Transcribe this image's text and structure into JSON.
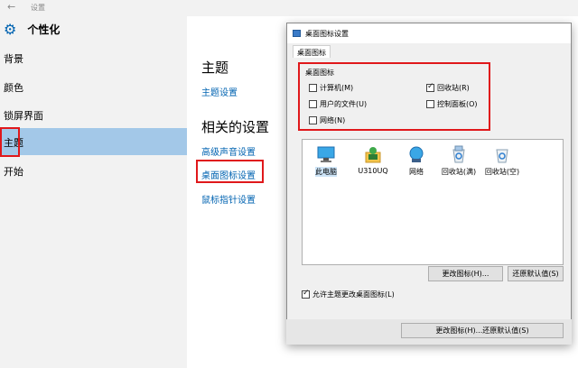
{
  "settings": {
    "window_title": "设置",
    "header_label": "个性化",
    "nav": [
      "背景",
      "颜色",
      "锁屏界面",
      "主题",
      "开始"
    ],
    "theme_heading": "主题",
    "theme_settings_link": "主题设置",
    "related_heading": "相关的设置",
    "related_links": [
      "高级声音设置",
      "桌面图标设置",
      "鼠标指针设置"
    ]
  },
  "dialog": {
    "title": "桌面图标设置",
    "tab": "桌面图标",
    "group_label": "桌面图标",
    "checkboxes": [
      {
        "label": "计算机(M)",
        "checked": false
      },
      {
        "label": "回收站(R)",
        "checked": true
      },
      {
        "label": "用户的文件(U)",
        "checked": false
      },
      {
        "label": "控制面板(O)",
        "checked": false
      },
      {
        "label": "网络(N)",
        "checked": false
      }
    ],
    "icons": [
      "此电脑",
      "U310UQ",
      "网络",
      "回收站(满)",
      "回收站(空)"
    ],
    "buttons": {
      "change_icon": "更改图标(H)...",
      "restore_default": "还原默认值(S)",
      "bottom": "更改图标(H)...还原默认值(S)"
    },
    "allow_themes": {
      "label": "允许主题更改桌面图标(L)",
      "checked": true
    }
  },
  "colors": {
    "accent": "#0063b1",
    "highlight": "#e0181b",
    "selected_nav": "#a3c8e8"
  }
}
